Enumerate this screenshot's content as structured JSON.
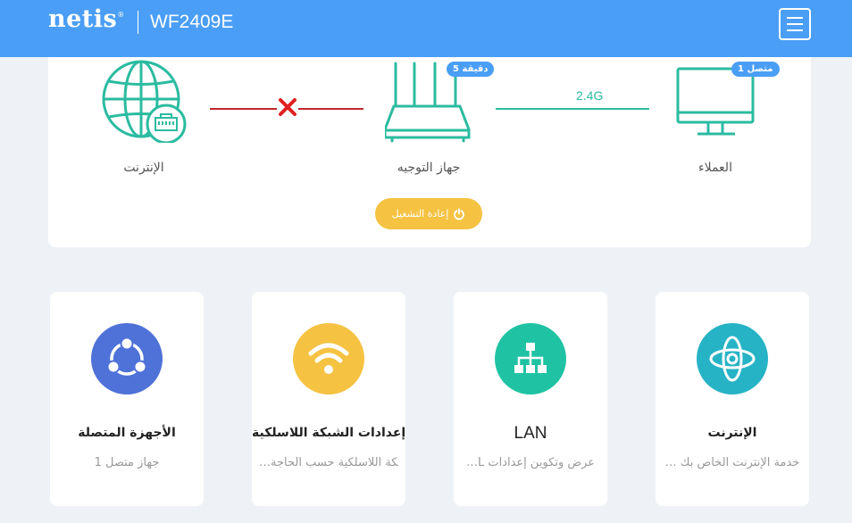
{
  "header": {
    "logo": "netis",
    "logo_mark": "®",
    "model": "WF2409E",
    "menu_icon": "hamburger-menu-icon"
  },
  "topology": {
    "internet": {
      "label": "الإنترنت",
      "icon": "globe-ethernet-icon",
      "status": "disconnected"
    },
    "router": {
      "label": "جهاز التوجيه",
      "icon": "router-icon",
      "uptime_badge": "دقيقة 5"
    },
    "clients": {
      "label": "العملاء",
      "icon": "monitor-icon",
      "count_badge": "متصل 1"
    },
    "wireless_band": "2.4G",
    "restart_label": "إعادة التشغيل"
  },
  "colors": {
    "header_bg": "#4a9ef5",
    "teal": "#2bbba0",
    "disconnected_red": "#c0272d",
    "restart_yellow": "#f5c242",
    "devices_blue": "#4f72d9"
  },
  "cards": [
    {
      "title": "الإنترنت",
      "desc": "… خدمة الإنترنت الخاص بك",
      "icon": "internet-orbit-icon"
    },
    {
      "title": "LAN",
      "desc": "…L عرض وتكوين إعدادات",
      "icon": "lan-topology-icon"
    },
    {
      "title": "إعدادات الشبكة اللاسلكية",
      "desc": "…بكة اللاسلكية حسب الحاجة",
      "icon": "wifi-icon"
    },
    {
      "title": "الأجهزة المتصلة",
      "desc": "جهاز متصل 1",
      "icon": "share-nodes-icon"
    }
  ]
}
